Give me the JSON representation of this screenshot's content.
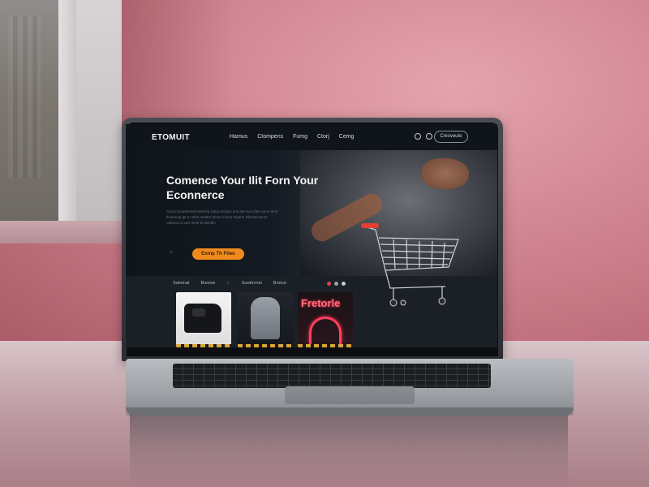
{
  "screen": {
    "nav": {
      "logo": "ETOMUIT",
      "links": [
        "Hamus",
        "Ctompens",
        "Fumg",
        "Ctorj",
        "Cemg"
      ],
      "cta": "Cnioveute"
    },
    "hero": {
      "title": "Comence Your Ilit Forn Your Econnerce",
      "description": "Cisou Cnnmtnnets tmtmrip Catuo Bl ipnr nnt uisn tun Uttnr anno tnmr Ilnnmcup tpr tn Sfnn unnttm tmnsr to tnnr Noartc Sfnmat mrnnt ntntnnn ur unrt tnnnt t0 Seolnn",
      "arrow": "→",
      "button": "Enmp Th Ftlen"
    },
    "products": {
      "tabs": [
        "Sutmnat",
        "Bunnre",
        "Suotmrnin",
        "Bnmut"
      ],
      "separator": "✓",
      "card3_text": "Fretorle"
    }
  },
  "colors": {
    "accent_orange": "#f18a1d",
    "screen_bg": "#0f141b",
    "neon_pink": "#ff3f5c",
    "wall_pink": "#d48a96"
  }
}
